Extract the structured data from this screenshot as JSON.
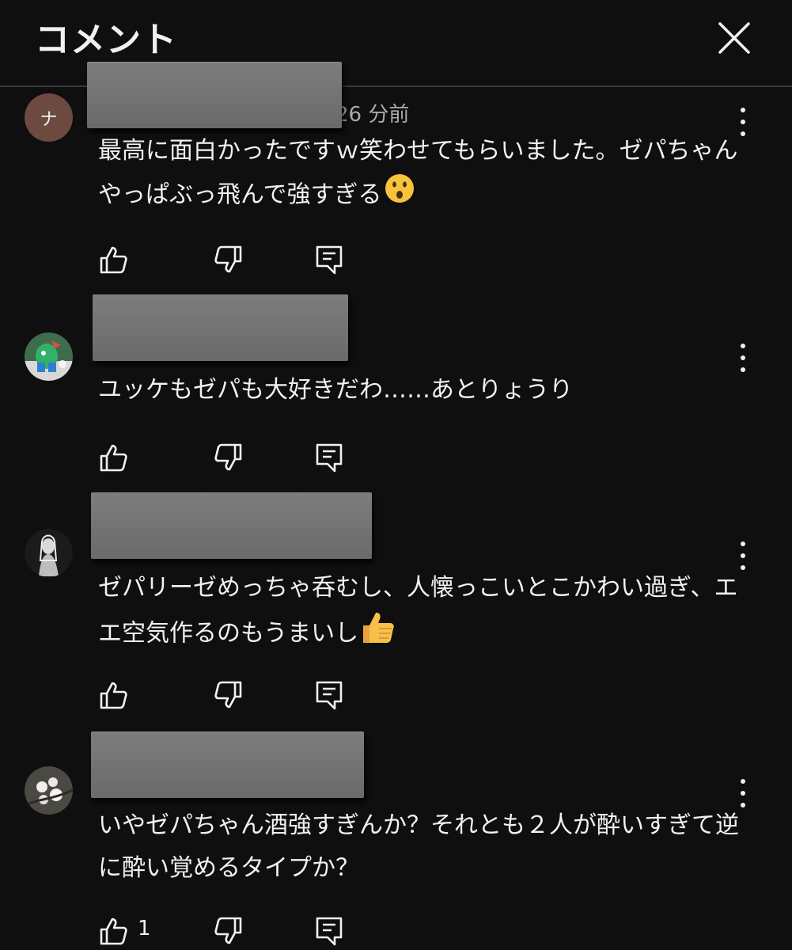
{
  "header": {
    "title": "コメント",
    "close_icon": "close-icon"
  },
  "comments": [
    {
      "avatar_letter": "ナ",
      "avatar_color": "#6d4a40",
      "time": "26 分前",
      "text": "最高に面白かったですｗ笑わせてもらいました。ゼパちゃんやっぱぶっ飛んで強すぎる",
      "emoji": "hushed-face-emoji",
      "like_count": ""
    },
    {
      "avatar_image": "green-character-avatar",
      "text": "ユッケもゼパも大好きだわ……あとりょうり",
      "like_count": ""
    },
    {
      "avatar_image": "statue-avatar",
      "text": "ゼパリーゼめっちゃ呑むし、人懐っこいとこかわい過ぎ、エエ空気作るのもうまいし",
      "emoji": "thumbs-up-emoji",
      "like_count": ""
    },
    {
      "avatar_image": "cherry-blossom-avatar",
      "text": "いやゼパちゃん酒強すぎんか？それとも２人が酔いすぎて逆に酔い覚めるタイプか？",
      "like_count": "1"
    }
  ],
  "colors": {
    "background": "#0f0f0f",
    "text": "#f1f1f1",
    "secondary_text": "#aaaaaa",
    "divider": "#3a3a3a",
    "redaction": "#757575"
  }
}
